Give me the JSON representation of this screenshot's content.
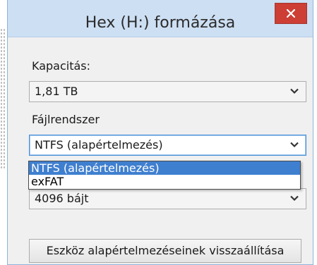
{
  "window": {
    "title": "Hex (H:) formázása"
  },
  "capacity": {
    "label": "Kapacitás:",
    "value": "1,81 TB"
  },
  "filesystem": {
    "label": "Fájlrendszer",
    "value": "NTFS (alapértelmezés)",
    "options": [
      {
        "label": "NTFS (alapértelmezés)",
        "selected": true
      },
      {
        "label": "exFAT",
        "selected": false
      }
    ]
  },
  "allocation": {
    "value": "4096 bájt"
  },
  "restore_button": {
    "label": "Eszköz alapértelmezéseinek visszaállítása"
  },
  "icons": {
    "close": "close-icon",
    "chevron": "chevron-down-icon"
  },
  "colors": {
    "titlebar": "#cddff3",
    "close": "#cd3e35",
    "selection": "#3f7fcf"
  }
}
